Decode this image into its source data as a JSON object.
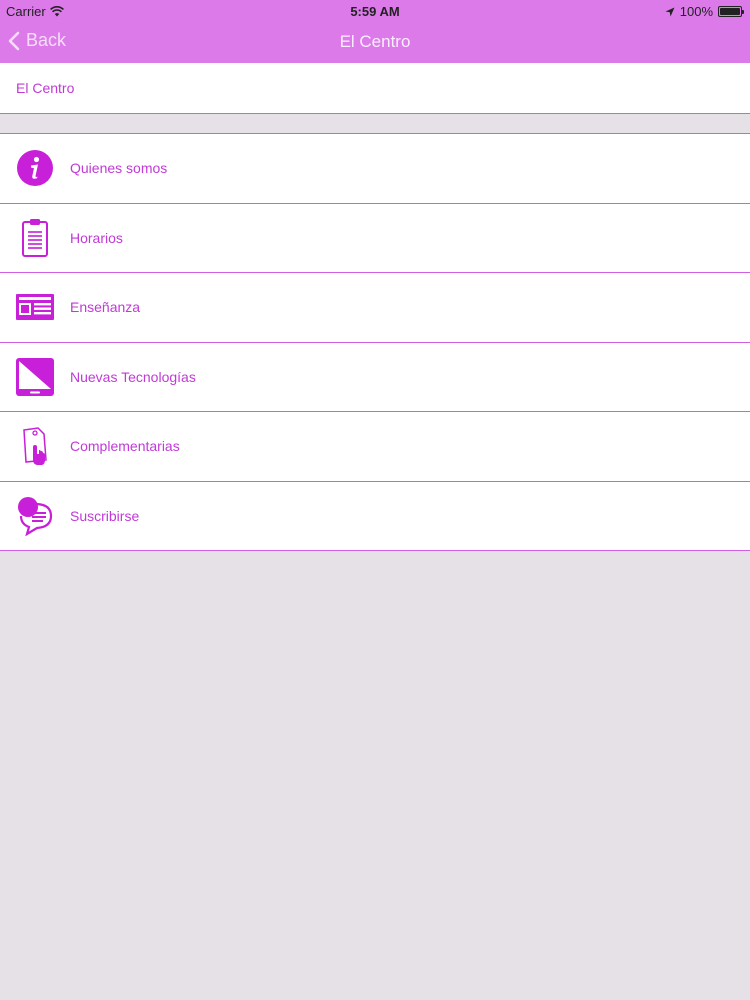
{
  "status_bar": {
    "carrier": "Carrier",
    "time": "5:59 AM",
    "battery": "100%",
    "battery_level": 1.0
  },
  "nav": {
    "back_label": "Back",
    "title": "El Centro"
  },
  "section": {
    "title": "El Centro"
  },
  "menu": {
    "items": [
      {
        "label": "Quienes somos",
        "icon": "info-icon"
      },
      {
        "label": "Horarios",
        "icon": "clipboard-icon"
      },
      {
        "label": "Enseñanza",
        "icon": "newspaper-icon"
      },
      {
        "label": "Nuevas Tecnologías",
        "icon": "tablet-icon"
      },
      {
        "label": "Complementarias",
        "icon": "tag-pointer-icon"
      },
      {
        "label": "Suscribirse",
        "icon": "chat-bubble-icon"
      }
    ]
  },
  "colors": {
    "accent": "#c13ad6",
    "navbar": "#dc7aea",
    "divider": "#d35ee6",
    "background": "#e6e1e6"
  }
}
